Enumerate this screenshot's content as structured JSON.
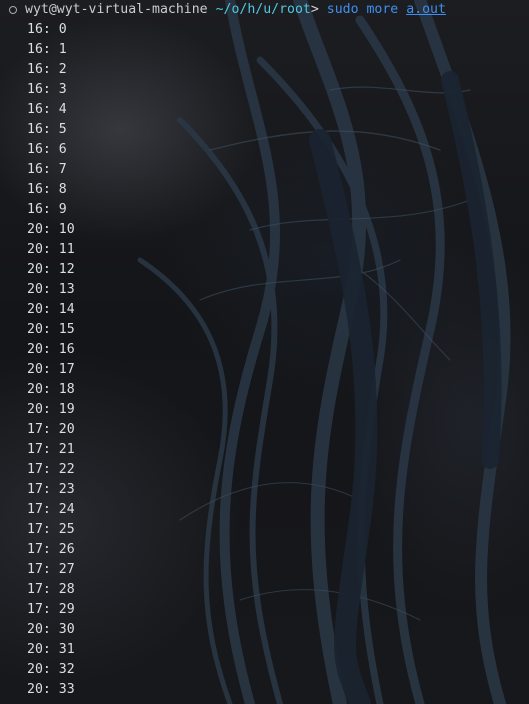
{
  "prompt": {
    "user_host": "wyt@wyt-virtual-machine",
    "path": "~/o/h/u/root",
    "arrow": ">",
    "command": "sudo",
    "sub_command": "more",
    "argument": "a.out"
  },
  "colors": {
    "path": "#4ec9e0",
    "command": "#3f8ff0",
    "text": "#dcdee2"
  },
  "output_lines": [
    "16: 0",
    "16: 1",
    "16: 2",
    "16: 3",
    "16: 4",
    "16: 5",
    "16: 6",
    "16: 7",
    "16: 8",
    "16: 9",
    "20: 10",
    "20: 11",
    "20: 12",
    "20: 13",
    "20: 14",
    "20: 15",
    "20: 16",
    "20: 17",
    "20: 18",
    "20: 19",
    "17: 20",
    "17: 21",
    "17: 22",
    "17: 23",
    "17: 24",
    "17: 25",
    "17: 26",
    "17: 27",
    "17: 28",
    "17: 29",
    "20: 30",
    "20: 31",
    "20: 32",
    "20: 33"
  ]
}
